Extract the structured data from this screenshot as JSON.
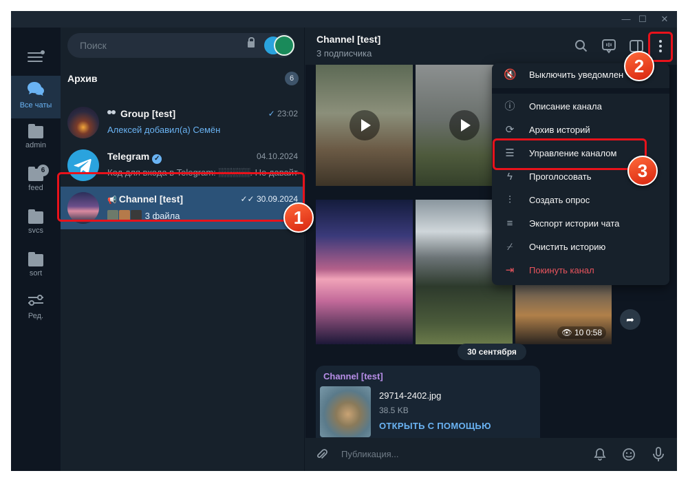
{
  "search": {
    "placeholder": "Поиск"
  },
  "folders": [
    {
      "label": "Все чаты",
      "badge": ""
    },
    {
      "label": "admin",
      "badge": ""
    },
    {
      "label": "feed",
      "badge": "6"
    },
    {
      "label": "svcs",
      "badge": ""
    },
    {
      "label": "sort",
      "badge": ""
    },
    {
      "label": "Ред.",
      "badge": ""
    }
  ],
  "archive": {
    "title": "Архив",
    "badge": "6"
  },
  "chats": [
    {
      "name": "Group [test]",
      "time": "23:02",
      "message": "Алексей добавил(а) Семён"
    },
    {
      "name": "Telegram",
      "time": "04.10.2024",
      "message": "Код для входа в Telegram: ░░░░░. Не давайте"
    },
    {
      "name": "Channel [test]",
      "time": "30.09.2024",
      "message": "3 файла"
    }
  ],
  "header": {
    "title": "Channel [test]",
    "subtitle": "3 подписчика"
  },
  "media": {
    "views": "10",
    "duration": "0:58"
  },
  "date_chip": "30 сентября",
  "message": {
    "sender": "Channel [test]",
    "file_name": "29714-2402.jpg",
    "file_size": "38.5 KB",
    "open_with": "ОТКРЫТЬ С ПОМОЩЬЮ"
  },
  "composer": {
    "placeholder": "Публикация..."
  },
  "menu": [
    {
      "label": "Выключить уведомлен",
      "icon": "mute-icon"
    },
    {
      "label": "Описание канала",
      "icon": "info-icon"
    },
    {
      "label": "Архив историй",
      "icon": "story-archive-icon"
    },
    {
      "label": "Управление каналом",
      "icon": "manage-icon"
    },
    {
      "label": "Проголосовать",
      "icon": "boost-icon"
    },
    {
      "label": "Создать опрос",
      "icon": "poll-icon"
    },
    {
      "label": "Экспорт истории чата",
      "icon": "export-icon"
    },
    {
      "label": "Очистить историю",
      "icon": "clear-icon"
    },
    {
      "label": "Покинуть канал",
      "icon": "leave-icon"
    }
  ],
  "callouts": [
    "1",
    "2",
    "3"
  ],
  "colors": {
    "accent": "#6ab3f3",
    "selected": "#2b5278",
    "danger": "#e8545d",
    "callout": "#e8121b"
  }
}
